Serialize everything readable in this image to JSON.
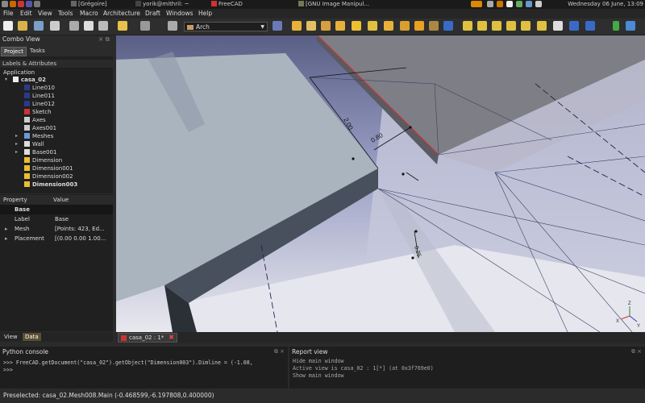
{
  "taskbar": {
    "tasks": [
      "[Grégoire]",
      "yorik@mithril: ~",
      "FreeCAD",
      "[GNU Image Manipul..."
    ],
    "clock": "Wednesday 06 June, 13:09"
  },
  "menubar": [
    "File",
    "Edit",
    "View",
    "Tools",
    "Macro",
    "Architecture",
    "Draft",
    "Windows",
    "Help"
  ],
  "toolbar": {
    "workbench": "Arch"
  },
  "combo_view": {
    "title": "Combo View",
    "tabs": [
      "Project",
      "Tasks"
    ],
    "active_tab": "Project",
    "labels_header": "Labels & Attributes",
    "application": "Application",
    "document": "casa_02",
    "tree": [
      "Line010",
      "Line011",
      "Line012",
      "Sketch",
      "Axes",
      "Axes001",
      "Meshes",
      "Wall",
      "Base001",
      "Dimension",
      "Dimension001",
      "Dimension002",
      "Dimension003"
    ]
  },
  "properties": {
    "col_property": "Property",
    "col_value": "Value",
    "group": "Base",
    "rows": [
      {
        "name": "Label",
        "value": "Base"
      },
      {
        "name": "Mesh",
        "value": "[Points: 423, Ed..."
      },
      {
        "name": "Placement",
        "value": "[(0.00 0.00 1.00..."
      }
    ],
    "view_tabs": [
      "View",
      "Data"
    ]
  },
  "viewport": {
    "doc_tab": "casa_02 : 1*",
    "dimensions": [
      "2.00",
      "0.80",
      "0.25"
    ],
    "axis_labels": [
      "Z",
      "X",
      "Y"
    ]
  },
  "python_console": {
    "title": "Python console",
    "lines": [
      ">>> FreeCAD.getDocument(\"casa_02\").getObject(\"Dimension003\").Dimline = (-1.08,",
      ">>> "
    ]
  },
  "report_view": {
    "title": "Report view",
    "lines": [
      "Hide main window",
      "Active view is casa_02 : 1[*] (at 0x3f769e0)",
      "Show main window"
    ]
  },
  "status": "Preselected: casa_02.Mesh008.Main (-0.468599,-6.197808,0.400000)"
}
